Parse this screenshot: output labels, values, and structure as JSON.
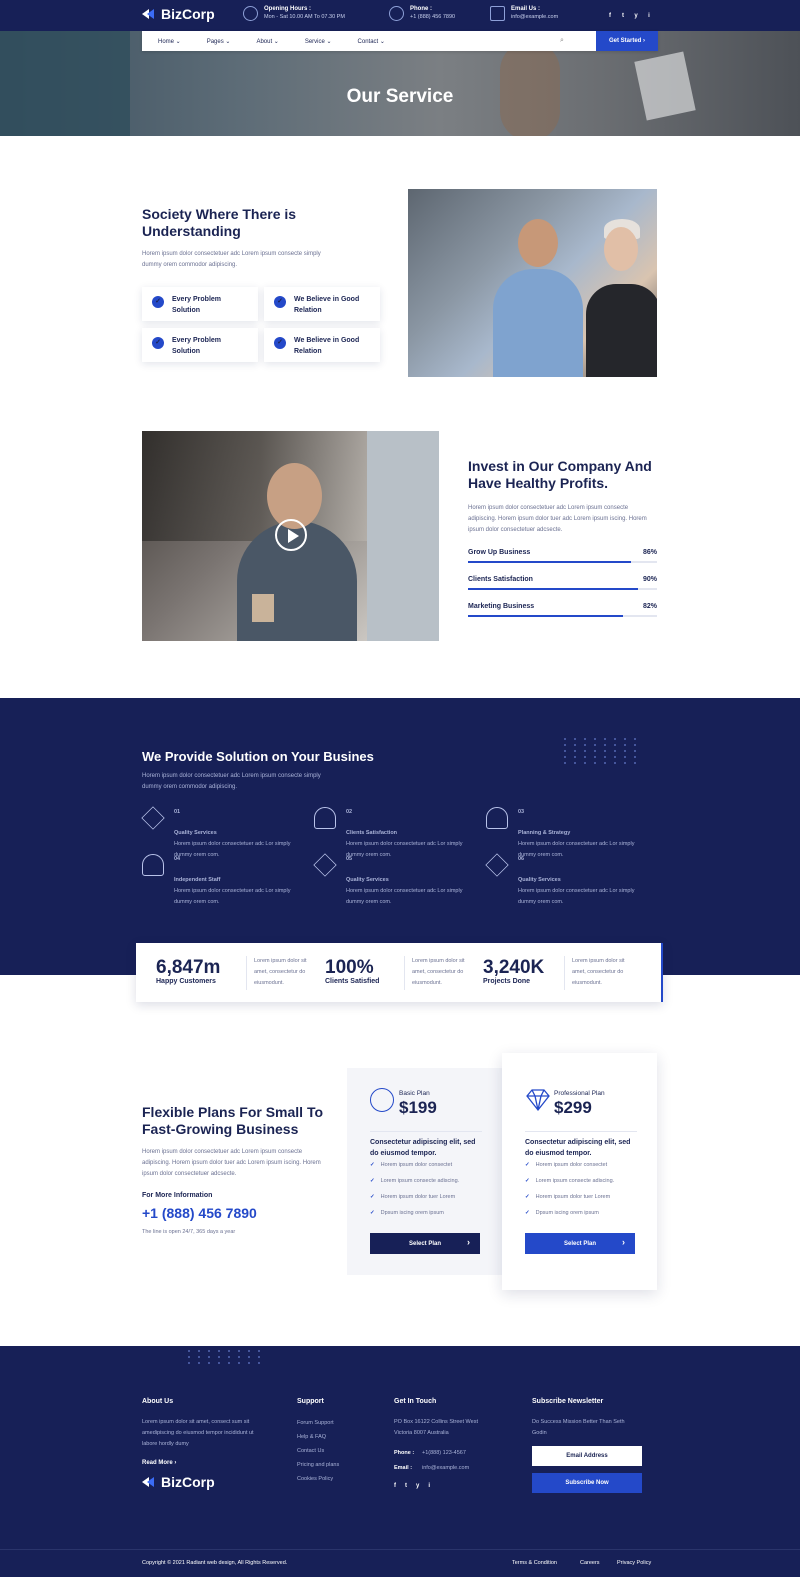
{
  "topbar": {
    "brand": "BizCorp",
    "hours_title": "Opening Hours :",
    "hours_value": "Mon - Sat 10.00 AM To 07.30 PM",
    "phone_title": "Phone :",
    "phone_value": "+1 (888) 456 7890",
    "email_title": "Email Us :",
    "email_value": "info@example.com",
    "social": [
      "f",
      "t",
      "y",
      "i"
    ]
  },
  "nav": {
    "items": [
      "Home",
      "Pages",
      "About",
      "Service",
      "Contact"
    ],
    "search_icon": "⌕",
    "cta": "Get Started ›"
  },
  "hero": {
    "title": "Our Service"
  },
  "about": {
    "title": "Society Where There is Understanding",
    "text": "Horem ipsum dolor consectetuer adc Lorem ipsum consecte simply dummy orem commodor adipiscing.",
    "features": [
      "Every Problem Solution",
      "We Believe in Good Relation",
      "Every Problem Solution",
      "We Believe in Good Relation"
    ]
  },
  "invest": {
    "title": "Invest in Our Company And Have Healthy Profits.",
    "text": "Horem ipsum dolor consectetuer adc Lorem ipsum consecte adipiscing. Horem ipsum dolor tuer adc Lorem ipsum iscing. Horem ipsum dolor consectetuer adcsecte.",
    "bars": [
      {
        "label": "Grow Up Business",
        "value": 86,
        "text": "86%"
      },
      {
        "label": "Clients Satisfaction",
        "value": 90,
        "text": "90%"
      },
      {
        "label": "Marketing Business",
        "value": 82,
        "text": "82%"
      }
    ]
  },
  "solutions": {
    "title": "We Provide Solution on Your Busines",
    "text": "Horem ipsum dolor consectetuer adc Lorem ipsum consecte simply dummy orem commodor adipiscing.",
    "items": [
      {
        "num": "01",
        "title": "Quality Services",
        "text": "Horem ipsum dolor consectetuer adc Lor simply dummy orem com."
      },
      {
        "num": "02",
        "title": "Clients Satisfaction",
        "text": "Horem ipsum dolor consectetuer adc Lor simply dummy orem com."
      },
      {
        "num": "03",
        "title": "Planning & Strategy",
        "text": "Horem ipsum dolor consectetuer adc Lor simply dummy orem com."
      },
      {
        "num": "04",
        "title": "Independent Staff",
        "text": "Horem ipsum dolor consectetuer adc Lor simply dummy orem com."
      },
      {
        "num": "05",
        "title": "Quality Services",
        "text": "Horem ipsum dolor consectetuer adc Lor simply dummy orem com."
      },
      {
        "num": "06",
        "title": "Quality Services",
        "text": "Horem ipsum dolor consectetuer adc Lor simply dummy orem com."
      }
    ]
  },
  "stats": [
    {
      "value": "6,847m",
      "label": "Happy Customers",
      "desc": "Lorem ipsum dolor sit amet, consectetur do eiusmodunt."
    },
    {
      "value": "100%",
      "label": "Clients Satisfied",
      "desc": "Lorem ipsum dolor sit amet, consectetur do eiusmodunt."
    },
    {
      "value": "3,240K",
      "label": "Projects Done",
      "desc": "Lorem ipsum dolor sit amet, consectetur do eiusmodunt."
    }
  ],
  "pricing": {
    "title": "Flexible Plans For Small To Fast-Growing Business",
    "text": "Horem ipsum dolor consectetuer adc Lorem ipsum consecte adipiscing. Horem ipsum dolor tuer adc Lorem ipsum iscing. Horem ipsum dolor consectetuer adcsecte.",
    "info_label": "For More Information",
    "phone": "+1 (888) 456 7890",
    "note": "The line is open 24/7, 365 days a year",
    "plans": [
      {
        "name": "Basic Plan",
        "price": "$199",
        "sub": "Consectetur adipiscing elit, sed do eiusmod tempor.",
        "features": [
          "Horem ipsum dolor consectet",
          "Lorem ipsum consecte adiscing.",
          "Horem ipsum dolor tuer Lorem",
          "Dpsum iscing orem ipsum"
        ],
        "button": "Select Plan"
      },
      {
        "name": "Professional Plan",
        "price": "$299",
        "sub": "Consectetur adipiscing elit, sed do eiusmod tempor.",
        "features": [
          "Horem ipsum dolor consectet",
          "Lorem ipsum consecte adiscing.",
          "Horem ipsum dolor tuer Lorem",
          "Dpsum iscing orem ipsum"
        ],
        "button": "Select Plan"
      }
    ]
  },
  "footer": {
    "about_title": "About Us",
    "about_text": "Lorem ipsum dolor sit amet, consect sum sit amedipiscing do eiusmod tempor incididunt ut labore hordly dumy",
    "read_more": "Read More ›",
    "brand": "BizCorp",
    "support_title": "Support",
    "support_links": [
      "Forum Support",
      "Help & FAQ",
      "Contact Us",
      "Pricing and plans",
      "Cookies Policy"
    ],
    "touch_title": "Get In Touch",
    "address": "PO Box 16122 Collins Street West Victoria 8007 Australia",
    "phone_label": "Phone :",
    "phone": "+1(888) 123-4567",
    "email_label": "Email :",
    "email": "info@example.com",
    "social": [
      "f",
      "t",
      "y",
      "i"
    ],
    "news_title": "Subscribe Newsletter",
    "news_text": "Do Success Mission Better Than Seth Godin",
    "email_placeholder": "Email Address",
    "subscribe": "Subscribe Now",
    "copyright": "Copyright © 2021 Radiant web design, All Rights Reserved.",
    "bottom_links": [
      "Terms & Condition",
      "Careers",
      "Privacy Policy"
    ]
  },
  "colors": {
    "navy": "#172057",
    "accent": "#2449c9"
  }
}
